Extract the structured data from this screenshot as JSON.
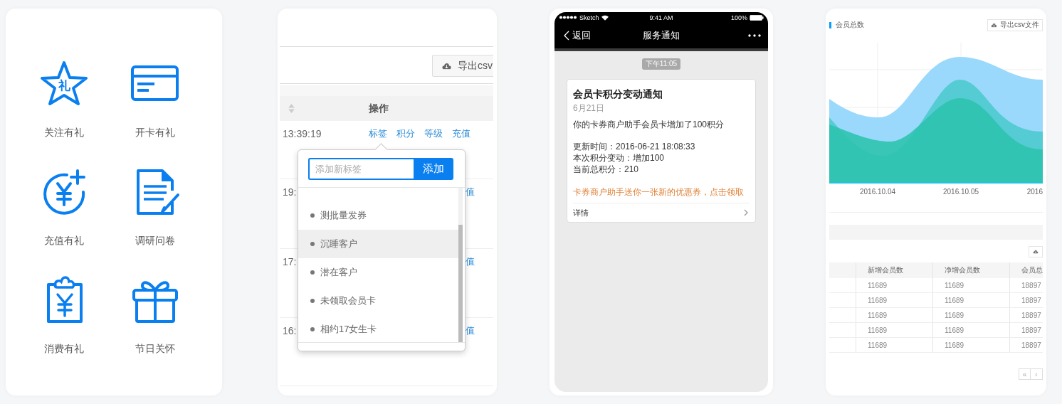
{
  "feature_grid": {
    "items": [
      {
        "label": "关注有礼",
        "kind": "star",
        "icon_text": "礼"
      },
      {
        "label": "开卡有礼",
        "kind": "card"
      },
      {
        "label": "充值有礼",
        "kind": "coin-plus"
      },
      {
        "label": "调研问卷",
        "kind": "document"
      },
      {
        "label": "消费有礼",
        "kind": "clipboard"
      },
      {
        "label": "节日关怀",
        "kind": "gift"
      }
    ]
  },
  "member_table_panel": {
    "export_button": "导出csv",
    "action_column": "操作",
    "rows": [
      {
        "time": "13:39:19",
        "actions": [
          "标签",
          "积分",
          "等级",
          "充值"
        ]
      },
      {
        "time": "19:",
        "actions": [
          "值"
        ]
      },
      {
        "time": "17:",
        "actions": [
          "值"
        ]
      },
      {
        "time": "16:",
        "actions": [
          "值"
        ]
      }
    ]
  },
  "tag_popover": {
    "input": {
      "placeholder": "添加新标签"
    },
    "add_button": "添加",
    "tags": [
      {
        "label": "测批量发券",
        "selected": false
      },
      {
        "label": "沉睡客户",
        "selected": true
      },
      {
        "label": "潜在客户",
        "selected": false
      },
      {
        "label": "未领取会员卡",
        "selected": false
      },
      {
        "label": "相约17女生卡",
        "selected": false
      }
    ]
  },
  "phone": {
    "status_bar": {
      "carrier": "Sketch",
      "time": "9:41 AM",
      "battery": "100%"
    },
    "nav": {
      "back": "返回",
      "title": "服务通知"
    },
    "time_badge": "下午11:05",
    "message": {
      "title": "会员卡积分变动通知",
      "date": "6月21日",
      "summary": "你的卡券商户助手会员卡增加了100积分",
      "details": [
        "更新时间：2016-06-21 18:08:33",
        "本次积分变动：增加100",
        "当前总积分：210"
      ],
      "link": "卡券商户助手送你一张新的优惠券，点击领取",
      "footer": "详情"
    }
  },
  "stats_panel": {
    "title": "会员总数",
    "export_button": "导出csv文件",
    "x_labels": [
      "2016.10.04",
      "2016.10.05",
      "2016"
    ],
    "table": {
      "columns": [
        "新增会员数",
        "净增会员数",
        "会员总"
      ],
      "rows": [
        [
          "11689",
          "11689",
          "18897"
        ],
        [
          "11689",
          "11689",
          "18897"
        ],
        [
          "11689",
          "11689",
          "18897"
        ],
        [
          "11689",
          "11689",
          "18897"
        ],
        [
          "11689",
          "11689",
          "18897"
        ]
      ]
    },
    "pagination": [
      "«",
      "‹"
    ]
  }
}
